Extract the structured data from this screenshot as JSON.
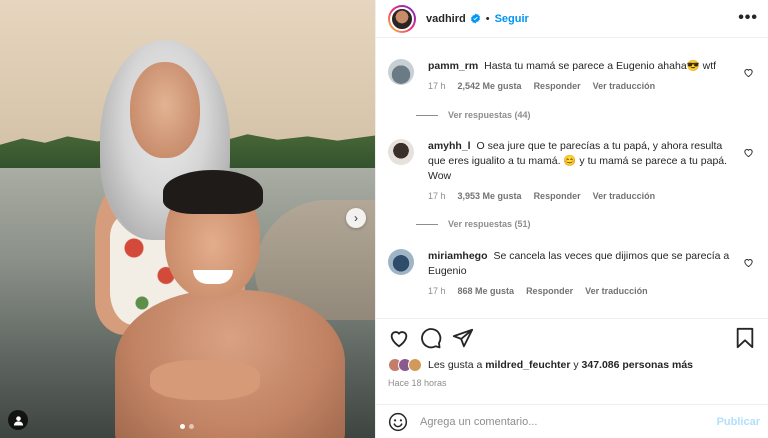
{
  "post": {
    "author": "vadhird",
    "follow_label": "Seguir",
    "separator": "•",
    "more_label": "•••"
  },
  "comments": [
    {
      "user": "pamm_rm",
      "text": "Hasta tu mamá se parece a Eugenio ahaha😎 wtf",
      "time": "17 h",
      "likes": "2,542 Me gusta",
      "reply": "Responder",
      "translate": "Ver traducción",
      "view_replies": "Ver respuestas (44)"
    },
    {
      "user": "amyhh_l",
      "text": "O sea jure que te parecías a tu papá, y ahora resulta que eres igualito a tu mamá. 😊 y tu mamá se parece a tu papá. Wow",
      "time": "17 h",
      "likes": "3,953 Me gusta",
      "reply": "Responder",
      "translate": "Ver traducción",
      "view_replies": "Ver respuestas (51)"
    },
    {
      "user": "miriamhego",
      "text": "Se cancela las veces que dijimos que se parecía a Eugenio",
      "time": "17 h",
      "likes": "868 Me gusta",
      "reply": "Responder",
      "translate": "Ver traducción"
    }
  ],
  "likes_summary": {
    "prefix": "Les gusta a",
    "user": "mildred_feuchter",
    "conj": "y",
    "count": "347.086 personas más"
  },
  "time_ago": "Hace 18 horas",
  "comment_input": {
    "placeholder": "Agrega un comentario...",
    "publish_label": "Publicar"
  },
  "carousel": {
    "next_glyph": "›",
    "current_slide": 1,
    "total_slides": 2
  },
  "colors": {
    "accent": "#0095f6",
    "publish_disabled": "#b2dffc",
    "secondary_text": "#8e8e8e"
  },
  "icons": [
    "user-tag-icon",
    "chevron-right-icon",
    "verified-badge-icon",
    "heart-icon",
    "comment-icon",
    "share-icon",
    "bookmark-icon",
    "emoji-icon",
    "more-options-icon"
  ]
}
